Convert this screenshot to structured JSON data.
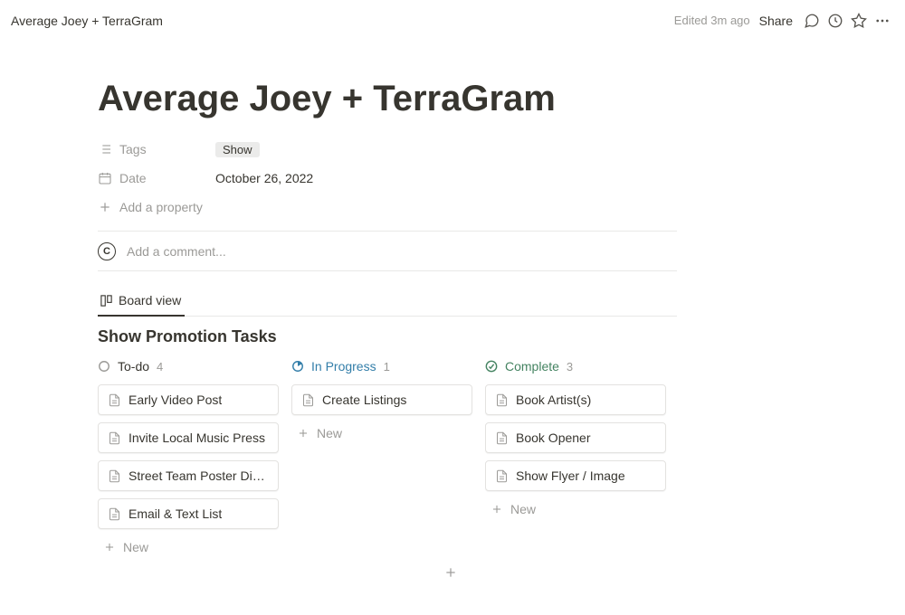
{
  "topbar": {
    "title": "Average Joey + TerraGram",
    "edited": "Edited 3m ago",
    "share": "Share"
  },
  "page": {
    "title": "Average Joey + TerraGram"
  },
  "properties": {
    "tags_label": "Tags",
    "tags_value": "Show",
    "date_label": "Date",
    "date_value": "October 26, 2022",
    "add_property": "Add a property"
  },
  "comment": {
    "avatar_letter": "C",
    "placeholder": "Add a comment..."
  },
  "view": {
    "board_label": "Board view"
  },
  "database": {
    "title": "Show Promotion Tasks"
  },
  "columns": {
    "todo": {
      "name": "To-do",
      "count": "4",
      "cards": [
        "Early Video Post",
        "Invite Local Music Press",
        "Street Team Poster Distribution",
        "Email & Text List"
      ]
    },
    "inprogress": {
      "name": "In Progress",
      "count": "1",
      "cards": [
        "Create Listings"
      ]
    },
    "complete": {
      "name": "Complete",
      "count": "3",
      "cards": [
        "Book Artist(s)",
        "Book Opener",
        "Show Flyer / Image"
      ]
    }
  },
  "new_label": "New"
}
